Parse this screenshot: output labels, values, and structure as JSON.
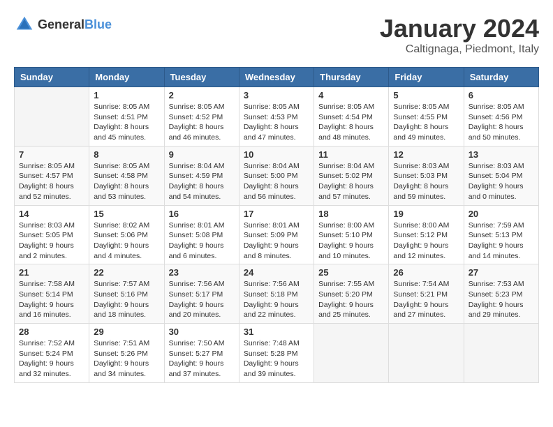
{
  "header": {
    "logo_general": "General",
    "logo_blue": "Blue",
    "title": "January 2024",
    "subtitle": "Caltignaga, Piedmont, Italy"
  },
  "weekdays": [
    "Sunday",
    "Monday",
    "Tuesday",
    "Wednesday",
    "Thursday",
    "Friday",
    "Saturday"
  ],
  "weeks": [
    [
      {
        "day": "",
        "info": ""
      },
      {
        "day": "1",
        "info": "Sunrise: 8:05 AM\nSunset: 4:51 PM\nDaylight: 8 hours\nand 45 minutes."
      },
      {
        "day": "2",
        "info": "Sunrise: 8:05 AM\nSunset: 4:52 PM\nDaylight: 8 hours\nand 46 minutes."
      },
      {
        "day": "3",
        "info": "Sunrise: 8:05 AM\nSunset: 4:53 PM\nDaylight: 8 hours\nand 47 minutes."
      },
      {
        "day": "4",
        "info": "Sunrise: 8:05 AM\nSunset: 4:54 PM\nDaylight: 8 hours\nand 48 minutes."
      },
      {
        "day": "5",
        "info": "Sunrise: 8:05 AM\nSunset: 4:55 PM\nDaylight: 8 hours\nand 49 minutes."
      },
      {
        "day": "6",
        "info": "Sunrise: 8:05 AM\nSunset: 4:56 PM\nDaylight: 8 hours\nand 50 minutes."
      }
    ],
    [
      {
        "day": "7",
        "info": "Sunrise: 8:05 AM\nSunset: 4:57 PM\nDaylight: 8 hours\nand 52 minutes."
      },
      {
        "day": "8",
        "info": "Sunrise: 8:05 AM\nSunset: 4:58 PM\nDaylight: 8 hours\nand 53 minutes."
      },
      {
        "day": "9",
        "info": "Sunrise: 8:04 AM\nSunset: 4:59 PM\nDaylight: 8 hours\nand 54 minutes."
      },
      {
        "day": "10",
        "info": "Sunrise: 8:04 AM\nSunset: 5:00 PM\nDaylight: 8 hours\nand 56 minutes."
      },
      {
        "day": "11",
        "info": "Sunrise: 8:04 AM\nSunset: 5:02 PM\nDaylight: 8 hours\nand 57 minutes."
      },
      {
        "day": "12",
        "info": "Sunrise: 8:03 AM\nSunset: 5:03 PM\nDaylight: 8 hours\nand 59 minutes."
      },
      {
        "day": "13",
        "info": "Sunrise: 8:03 AM\nSunset: 5:04 PM\nDaylight: 9 hours\nand 0 minutes."
      }
    ],
    [
      {
        "day": "14",
        "info": "Sunrise: 8:03 AM\nSunset: 5:05 PM\nDaylight: 9 hours\nand 2 minutes."
      },
      {
        "day": "15",
        "info": "Sunrise: 8:02 AM\nSunset: 5:06 PM\nDaylight: 9 hours\nand 4 minutes."
      },
      {
        "day": "16",
        "info": "Sunrise: 8:01 AM\nSunset: 5:08 PM\nDaylight: 9 hours\nand 6 minutes."
      },
      {
        "day": "17",
        "info": "Sunrise: 8:01 AM\nSunset: 5:09 PM\nDaylight: 9 hours\nand 8 minutes."
      },
      {
        "day": "18",
        "info": "Sunrise: 8:00 AM\nSunset: 5:10 PM\nDaylight: 9 hours\nand 10 minutes."
      },
      {
        "day": "19",
        "info": "Sunrise: 8:00 AM\nSunset: 5:12 PM\nDaylight: 9 hours\nand 12 minutes."
      },
      {
        "day": "20",
        "info": "Sunrise: 7:59 AM\nSunset: 5:13 PM\nDaylight: 9 hours\nand 14 minutes."
      }
    ],
    [
      {
        "day": "21",
        "info": "Sunrise: 7:58 AM\nSunset: 5:14 PM\nDaylight: 9 hours\nand 16 minutes."
      },
      {
        "day": "22",
        "info": "Sunrise: 7:57 AM\nSunset: 5:16 PM\nDaylight: 9 hours\nand 18 minutes."
      },
      {
        "day": "23",
        "info": "Sunrise: 7:56 AM\nSunset: 5:17 PM\nDaylight: 9 hours\nand 20 minutes."
      },
      {
        "day": "24",
        "info": "Sunrise: 7:56 AM\nSunset: 5:18 PM\nDaylight: 9 hours\nand 22 minutes."
      },
      {
        "day": "25",
        "info": "Sunrise: 7:55 AM\nSunset: 5:20 PM\nDaylight: 9 hours\nand 25 minutes."
      },
      {
        "day": "26",
        "info": "Sunrise: 7:54 AM\nSunset: 5:21 PM\nDaylight: 9 hours\nand 27 minutes."
      },
      {
        "day": "27",
        "info": "Sunrise: 7:53 AM\nSunset: 5:23 PM\nDaylight: 9 hours\nand 29 minutes."
      }
    ],
    [
      {
        "day": "28",
        "info": "Sunrise: 7:52 AM\nSunset: 5:24 PM\nDaylight: 9 hours\nand 32 minutes."
      },
      {
        "day": "29",
        "info": "Sunrise: 7:51 AM\nSunset: 5:26 PM\nDaylight: 9 hours\nand 34 minutes."
      },
      {
        "day": "30",
        "info": "Sunrise: 7:50 AM\nSunset: 5:27 PM\nDaylight: 9 hours\nand 37 minutes."
      },
      {
        "day": "31",
        "info": "Sunrise: 7:48 AM\nSunset: 5:28 PM\nDaylight: 9 hours\nand 39 minutes."
      },
      {
        "day": "",
        "info": ""
      },
      {
        "day": "",
        "info": ""
      },
      {
        "day": "",
        "info": ""
      }
    ]
  ]
}
